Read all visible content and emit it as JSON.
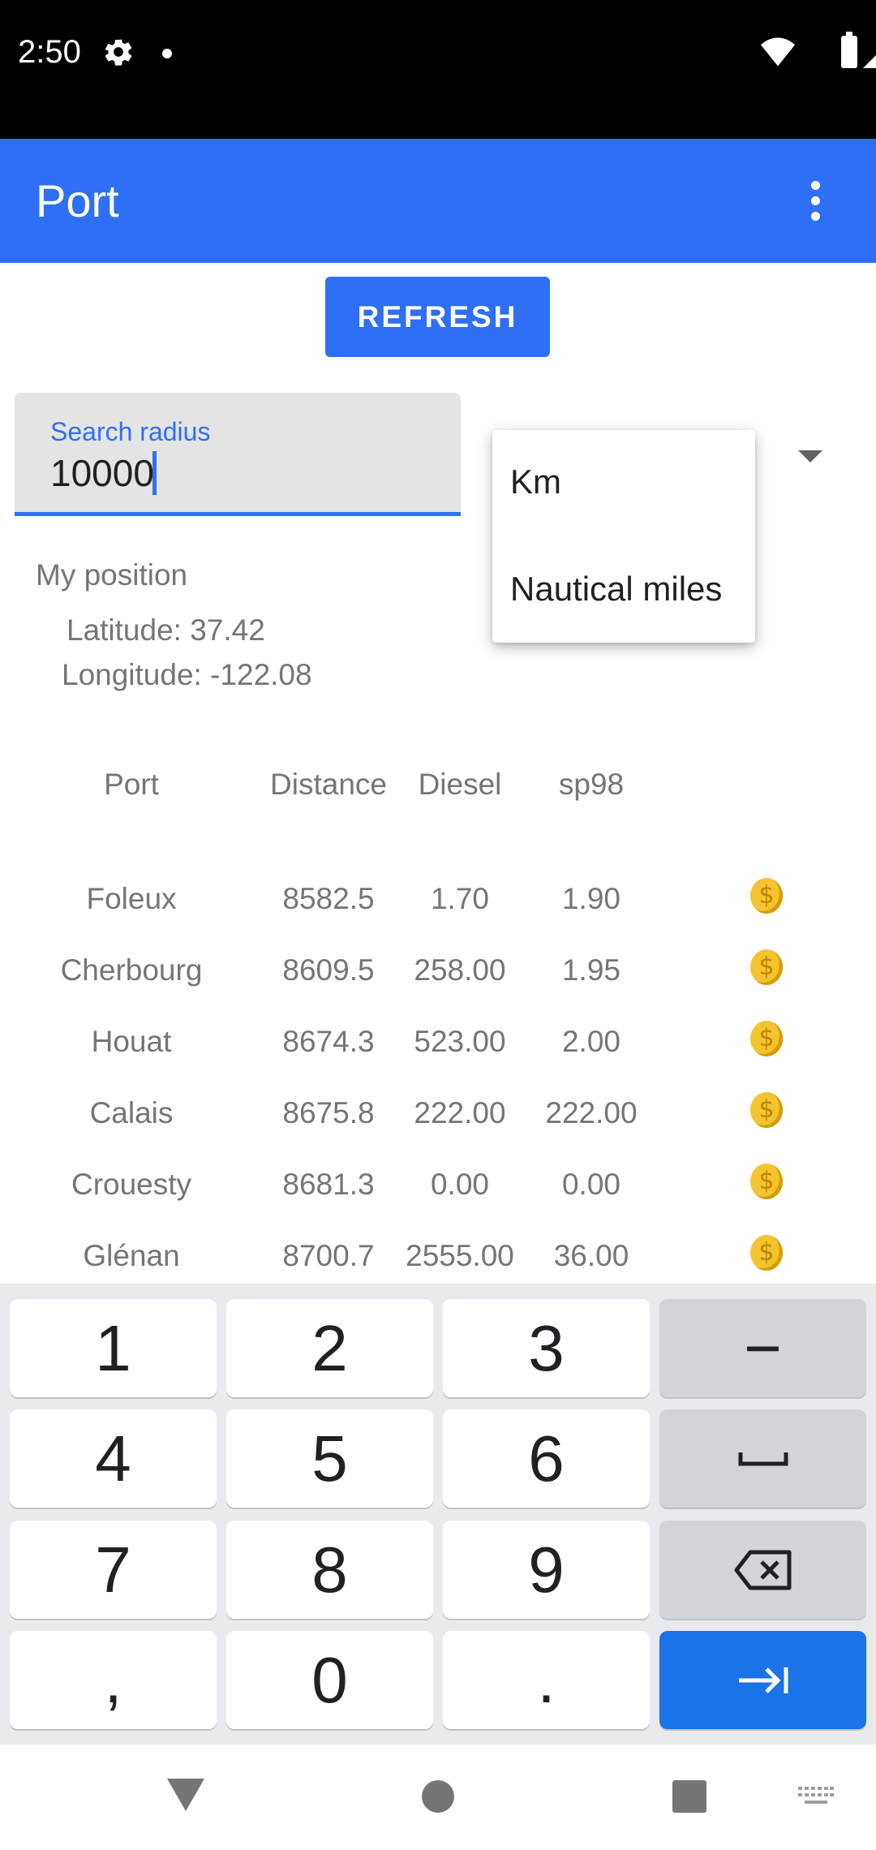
{
  "status_bar": {
    "time": "2:50"
  },
  "app_bar": {
    "title": "Port"
  },
  "refresh_label": "REFRESH",
  "search": {
    "label": "Search radius",
    "value": "10000"
  },
  "unit_menu": {
    "options": [
      "Km",
      "Nautical miles"
    ]
  },
  "position": {
    "heading": "My position",
    "latitude": "Latitude: 37.42",
    "longitude": "Longitude: -122.08"
  },
  "table": {
    "headers": [
      "Port",
      "Distance",
      "Diesel",
      "sp98"
    ],
    "rows": [
      [
        "Foleux",
        "8582.5",
        "1.70",
        "1.90"
      ],
      [
        "Cherbourg",
        "8609.5",
        "258.00",
        "1.95"
      ],
      [
        "Houat",
        "8674.3",
        "523.00",
        "2.00"
      ],
      [
        "Calais",
        "8675.8",
        "222.00",
        "222.00"
      ],
      [
        "Crouesty",
        "8681.3",
        "0.00",
        "0.00"
      ],
      [
        "Glénan",
        "8700.7",
        "2555.00",
        "36.00"
      ]
    ]
  },
  "keyboard": {
    "rows": [
      [
        "1",
        "2",
        "3",
        "−"
      ],
      [
        "4",
        "5",
        "6",
        "space"
      ],
      [
        "7",
        "8",
        "9",
        "backspace"
      ],
      [
        ",",
        "0",
        ".",
        "next"
      ]
    ]
  },
  "icons": {
    "status_bar": [
      "gear-icon",
      "dot-icon",
      "wifi-icon",
      "cell-signal-icon",
      "battery-icon"
    ],
    "table_row_action": "coin-icon",
    "nav_bar": [
      "back-icon",
      "home-icon",
      "recents-icon",
      "keyboard-icon"
    ]
  },
  "colors": {
    "primary": "#2f6ff5",
    "key_blue": "#1a73e8"
  }
}
